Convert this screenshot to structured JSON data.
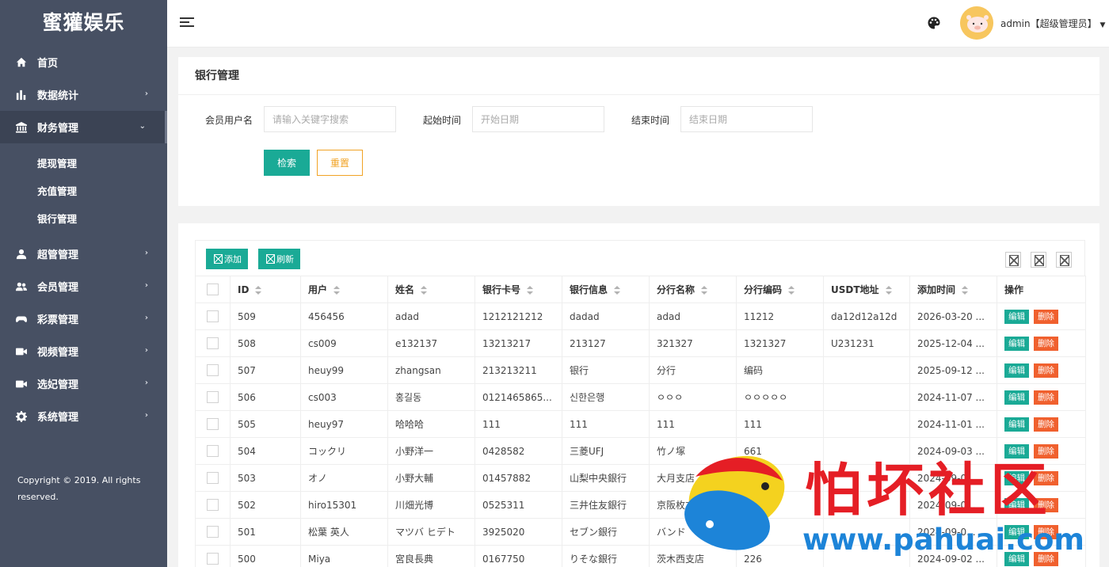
{
  "brand": "蜜獾娱乐",
  "sidebar": {
    "items": [
      {
        "label": "首页",
        "icon": "home-icon"
      },
      {
        "label": "数据统计",
        "icon": "bar-chart-icon"
      },
      {
        "label": "财务管理",
        "icon": "bank-icon"
      },
      {
        "label": "超管管理",
        "icon": "user-icon"
      },
      {
        "label": "会员管理",
        "icon": "users-icon"
      },
      {
        "label": "彩票管理",
        "icon": "gamepad-icon"
      },
      {
        "label": "视频管理",
        "icon": "video-icon"
      },
      {
        "label": "选妃管理",
        "icon": "video-icon"
      },
      {
        "label": "系统管理",
        "icon": "gear-icon"
      }
    ],
    "sub_items": [
      "提现管理",
      "充值管理",
      "银行管理"
    ],
    "copyright": "Copyright © 2019. All rights reserved."
  },
  "header": {
    "user": "admin【超级管理员】"
  },
  "search": {
    "title": "银行管理",
    "username_label": "会员用户名",
    "username_placeholder": "请输入关键字搜索",
    "start_label": "起始时间",
    "start_placeholder": "开始日期",
    "end_label": "结束时间",
    "end_placeholder": "结束日期",
    "search_button": "检索",
    "reset_button": "重置"
  },
  "toolbar": {
    "add": "添加",
    "refresh": "刷新"
  },
  "table": {
    "columns": [
      "ID",
      "用户",
      "姓名",
      "银行卡号",
      "银行信息",
      "分行名称",
      "分行编码",
      "USDT地址",
      "添加时间",
      "操作"
    ],
    "edit_label": "编辑",
    "delete_label": "删除",
    "rows": [
      [
        "509",
        "456456",
        "adad",
        "1212121212",
        "dadad",
        "adad",
        "11212",
        "da12d12a12d",
        "2026-03-20 ..."
      ],
      [
        "508",
        "cs009",
        "e132137",
        "13213217",
        "213127",
        "321327",
        "1321327",
        "U231231",
        "2025-12-04 ..."
      ],
      [
        "507",
        "heuy99",
        "zhangsan",
        "213213211",
        "银行",
        "分行",
        "编码",
        "",
        "2025-09-12 ..."
      ],
      [
        "506",
        "cs003",
        "홍길동",
        "0121465865...",
        "신한은행",
        "ㅇㅇㅇ",
        "ㅇㅇㅇㅇㅇ",
        "",
        "2024-11-07 ..."
      ],
      [
        "505",
        "heuy97",
        "哈哈哈",
        "111",
        "111",
        "111",
        "111",
        "",
        "2024-11-01 ..."
      ],
      [
        "504",
        "コックリ",
        "小野洋一",
        "0428582",
        "三菱UFJ",
        "竹ノ塚",
        "661",
        "",
        "2024-09-03 ..."
      ],
      [
        "503",
        "オノ",
        "小野大輔",
        "01457882",
        "山梨中央銀行",
        "大月支店",
        "",
        "",
        "2024-09-0..."
      ],
      [
        "502",
        "hiro15301",
        "川畑光博",
        "0525311",
        "三井住友銀行",
        "京阪枚方支店",
        "",
        "",
        "2024-09-0..."
      ],
      [
        "501",
        "松葉 英人",
        "マツバ ヒデト",
        "3925020",
        "セブン銀行",
        "バンド",
        "10",
        "",
        "2024-09-0..."
      ],
      [
        "500",
        "Miya",
        "宮良長典",
        "0167750",
        "りそな銀行",
        "茨木西支店",
        "226",
        "",
        "2024-09-02 ..."
      ]
    ]
  },
  "watermark": {
    "text": "怕坏社区",
    "url": "www.pahuai.com"
  },
  "colors": {
    "sidebar": "#475063",
    "primary": "#1aaa96",
    "warning": "#f1a325",
    "danger": "#f0602e"
  }
}
